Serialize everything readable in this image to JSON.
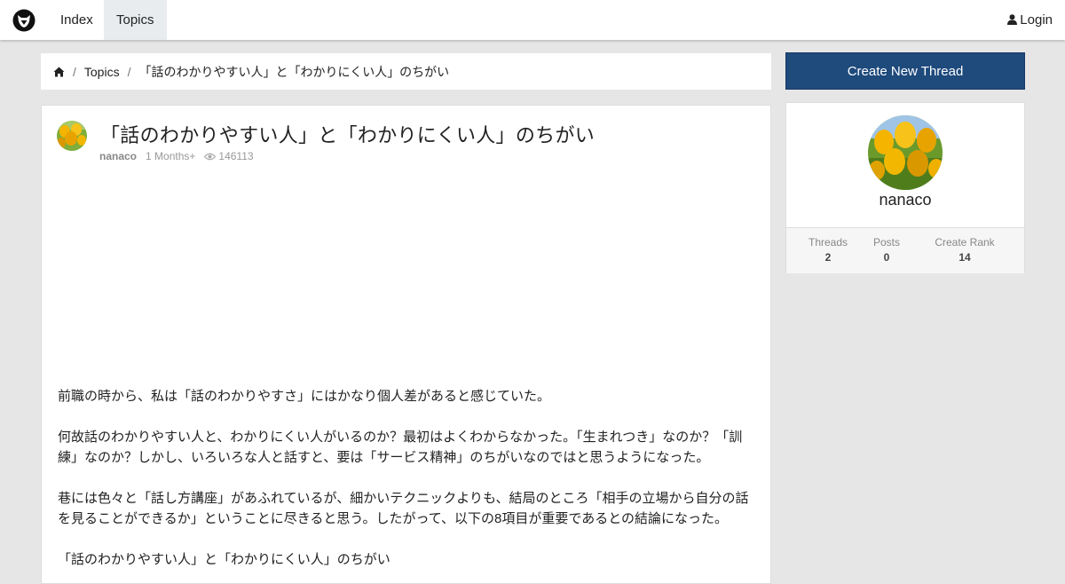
{
  "nav": {
    "index_label": "Index",
    "topics_label": "Topics",
    "login_label": "Login"
  },
  "breadcrumb": {
    "home_icon": "home-icon",
    "topics_label": "Topics",
    "current": "「話のわかりやすい人」と「わかりにくい人」のちがい"
  },
  "thread": {
    "title": "「話のわかりやすい人」と「わかりにくい人」のちがい",
    "author": "nanaco",
    "age": "1 Months+",
    "views": "146113",
    "paragraphs": [
      "前職の時から、私は「話のわかりやすさ」にはかなり個人差があると感じていた。",
      "何故話のわかりやすい人と、わかりにくい人がいるのか？最初はよくわからなかった。「生まれつき」なのか？「訓練」なのか？しかし、いろいろな人と話すと、要は「サービス精神」のちがいなのではと思うようになった。",
      "巷には色々と「話し方講座」があふれているが、細かいテクニックよりも、結局のところ「相手の立場から自分の話を見ることができるか」ということに尽きると思う。したがって、以下の8項目が重要であるとの結論になった。",
      "「話のわかりやすい人」と「わかりにくい人」のちがい"
    ]
  },
  "sidebar": {
    "create_label": "Create New Thread",
    "profile_name": "nanaco",
    "stats": {
      "threads_label": "Threads",
      "threads_value": "2",
      "posts_label": "Posts",
      "posts_value": "0",
      "rank_label": "Create Rank",
      "rank_value": "14"
    }
  },
  "colors": {
    "primary_button": "#1e4a7c",
    "background": "#e6e6e6"
  }
}
